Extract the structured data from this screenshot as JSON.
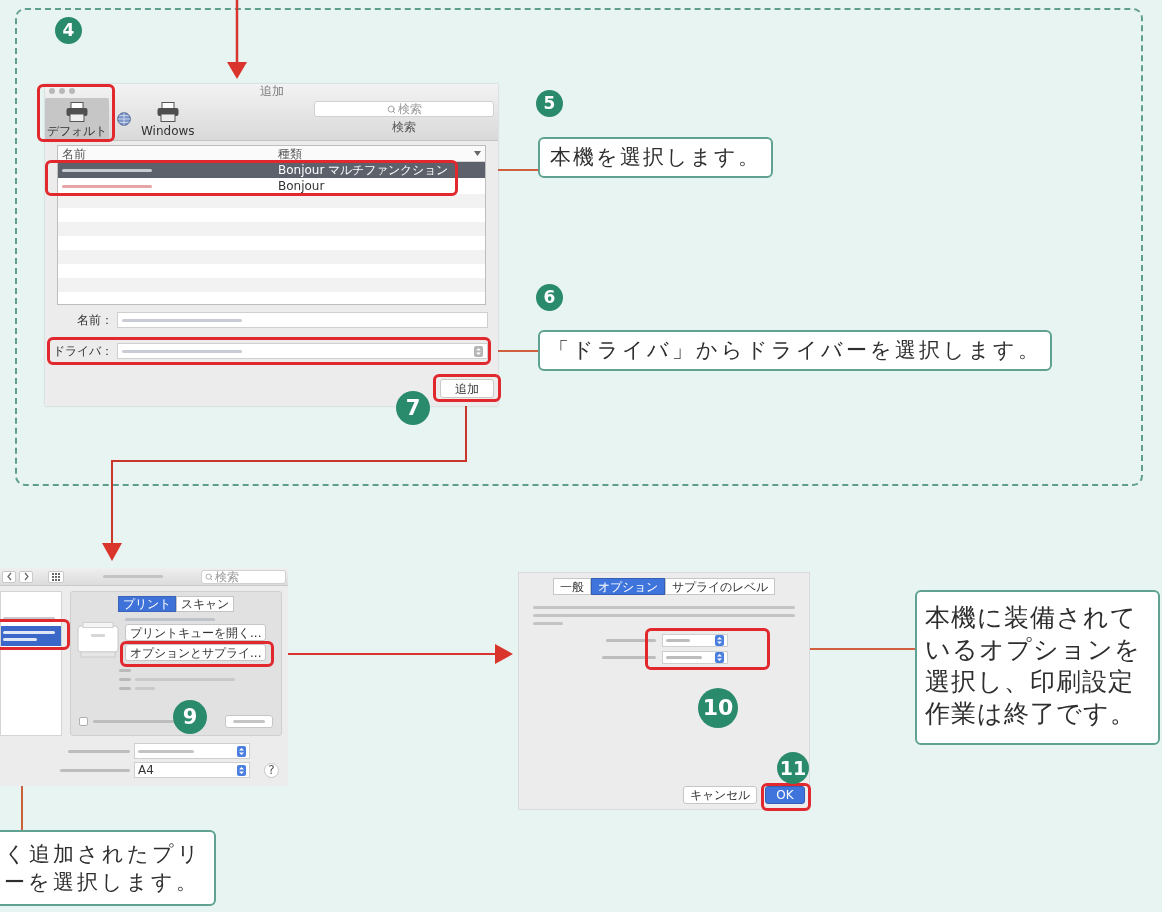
{
  "add_dialog": {
    "step": "4",
    "title": "追加",
    "toolbar": [
      {
        "kind": "printer",
        "label": "デフォルト",
        "selected": true
      },
      {
        "kind": "globe",
        "selected": false
      },
      {
        "kind": "printer",
        "label": "Windows",
        "selected": false
      }
    ],
    "search": {
      "placeholder": "検索",
      "caption": "検索"
    },
    "list": {
      "columns": [
        "名前",
        "種類"
      ],
      "rows": [
        {
          "kind_label": "Bonjour マルチファンクション",
          "selected": true
        },
        {
          "kind_label": "Bonjour",
          "selected": false
        }
      ]
    },
    "fields": [
      {
        "label": "名前：",
        "kind": "text"
      },
      {
        "label": "ドライバ：",
        "kind": "popup"
      }
    ],
    "add_button": {
      "label": "追加",
      "step": "7"
    }
  },
  "callouts": [
    {
      "step": "5",
      "text": "本機を選択します。"
    },
    {
      "step": "6",
      "text": "「ドライバ」からドライバーを選択します。"
    }
  ],
  "printers_window": {
    "search_placeholder": "検索",
    "sidebar_rows": [
      {
        "selected": false
      },
      {
        "selected": true
      }
    ],
    "tabs": [
      {
        "label": "プリント",
        "selected": true
      },
      {
        "label": "スキャン",
        "selected": false
      }
    ],
    "buttons": [
      "プリントキューを開く...",
      "オプションとサプライ..."
    ],
    "step": "9",
    "share_checkbox": {
      "checked": false
    },
    "paper_size": "A4",
    "help": "?",
    "callout_lines": [
      "く追加されたプリ",
      "ーを選択します。"
    ]
  },
  "options_window": {
    "tabs": [
      {
        "label": "一般",
        "selected": false
      },
      {
        "label": "オプション",
        "selected": true
      },
      {
        "label": "サプライのレベル",
        "selected": false
      }
    ],
    "popups_step": "10",
    "ok_step": "11",
    "buttons": [
      {
        "label": "キャンセル",
        "kind": "secondary"
      },
      {
        "label": "OK",
        "kind": "primary"
      }
    ],
    "callout_lines": [
      "本機に装備されて",
      "いるオプションを",
      "選択し、印刷設定",
      "作業は終了です。"
    ]
  }
}
